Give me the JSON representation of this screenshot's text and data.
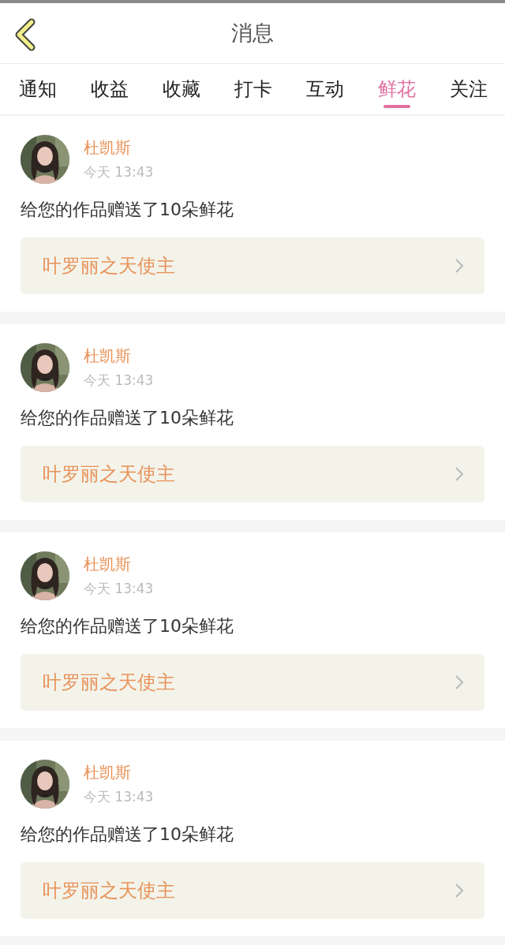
{
  "header": {
    "title": "消息"
  },
  "tabs": [
    {
      "label": "通知",
      "selected": false
    },
    {
      "label": "收益",
      "selected": false
    },
    {
      "label": "收藏",
      "selected": false
    },
    {
      "label": "打卡",
      "selected": false
    },
    {
      "label": "互动",
      "selected": false
    },
    {
      "label": "鲜花",
      "selected": true
    },
    {
      "label": "关注",
      "selected": false
    }
  ],
  "messages": [
    {
      "name": "杜凯斯",
      "time": "今天 13:43",
      "text": "给您的作品赠送了10朵鲜花",
      "work": "叶罗丽之天使主"
    },
    {
      "name": "杜凯斯",
      "time": "今天 13:43",
      "text": "给您的作品赠送了10朵鲜花",
      "work": "叶罗丽之天使主"
    },
    {
      "name": "杜凯斯",
      "time": "今天 13:43",
      "text": "给您的作品赠送了10朵鲜花",
      "work": "叶罗丽之天使主"
    },
    {
      "name": "杜凯斯",
      "time": "今天 13:43",
      "text": "给您的作品赠送了10朵鲜花",
      "work": "叶罗丽之天使主"
    }
  ]
}
